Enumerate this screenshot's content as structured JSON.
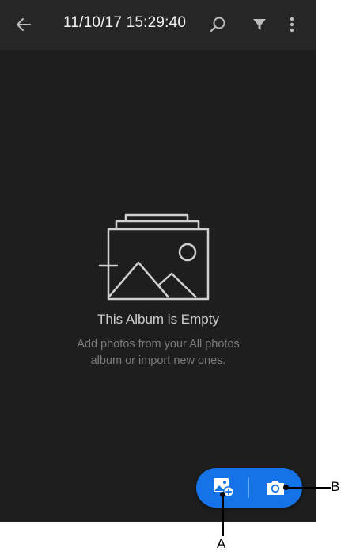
{
  "header": {
    "title": "11/10/17 15:29:40",
    "icons": [
      "back-arrow-icon",
      "search-icon",
      "filter-icon",
      "more-vertical-icon"
    ]
  },
  "empty_state": {
    "icon": "empty-album-illustration",
    "title": "This Album is Empty",
    "subtitle_line1": "Add photos from your All photos",
    "subtitle_line2": "album or import new ones."
  },
  "fab": {
    "add_photos_icon": "add-photos-icon",
    "camera_icon": "camera-icon"
  },
  "callouts": {
    "a": "A",
    "b": "B"
  },
  "colors": {
    "background": "#1e1e1e",
    "topbar": "#262626",
    "accent": "#1473e6"
  }
}
